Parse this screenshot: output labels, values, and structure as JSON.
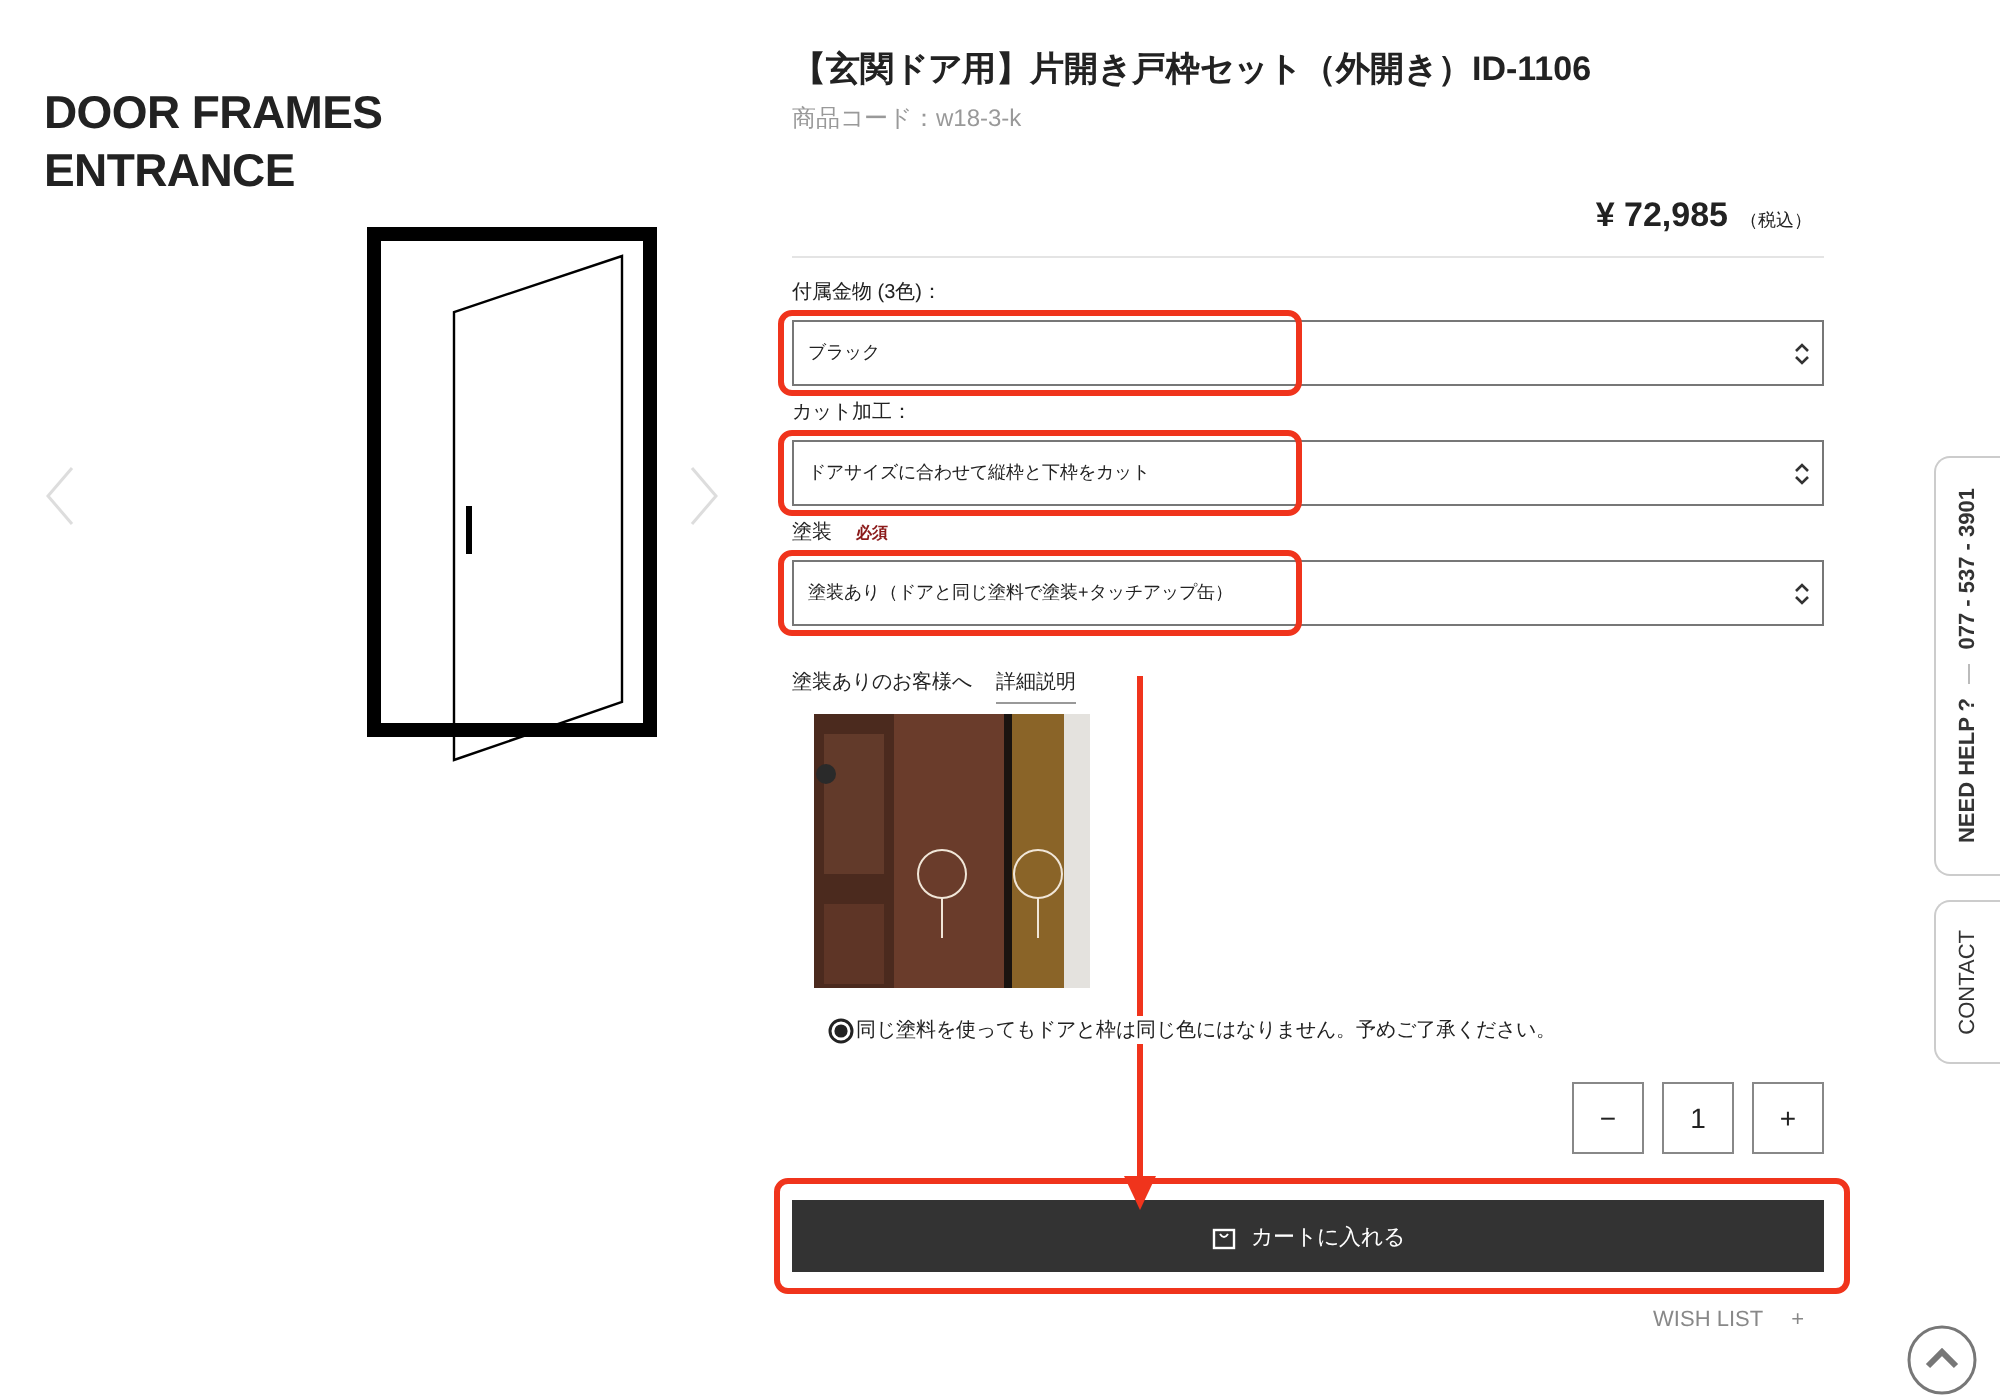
{
  "brand_heading": [
    "DOOR FRAMES",
    "ENTRANCE"
  ],
  "product": {
    "title": "【玄関ドア用】片開き戸枠セット（外開き）ID-1106",
    "code": "商品コード：w18-3-k",
    "price": "¥ 72,985",
    "tax_note": "（税込）"
  },
  "options": [
    {
      "label": "付属金物 (3色)：",
      "value": "ブラック"
    },
    {
      "label": "カット加工：",
      "value": "ドアサイズに合わせて縦枠と下枠をカット"
    },
    {
      "label": "塗装",
      "required_text": "必須",
      "value": "塗装あり（ドアと同じ塗料で塗装+タッチアップ缶）"
    }
  ],
  "paint_note": {
    "text": "塗装ありのお客様へ",
    "link": "詳細説明"
  },
  "notice": "同じ塗料を使ってもドアと枠は同じ色にはなりません。予めご了承ください。",
  "quantity": {
    "minus": "−",
    "value": "1",
    "plus": "+"
  },
  "cart_button": "カートに入れる",
  "wish_list": {
    "label": "WISH LIST",
    "plus": "+"
  },
  "side_tabs": {
    "need_help": "NEED HELP ?",
    "phone": "077 - 537 - 3901",
    "contact": "CONTACT"
  }
}
